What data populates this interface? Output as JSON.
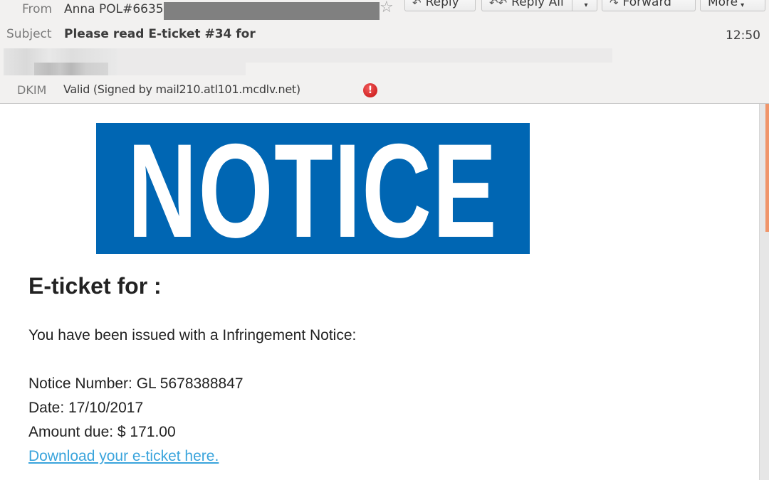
{
  "header": {
    "from_label": "From",
    "from_value": "Anna POL#6635",
    "subject_label": "Subject",
    "subject_value": "Please read E-ticket #34 for",
    "time": "12:50",
    "dkim_label": "DKIM",
    "dkim_value": "Valid (Signed by mail210.atl101.mcdlv.net)",
    "dkim_warning_glyph": "!",
    "star_glyph": "☆"
  },
  "toolbar": {
    "reply_label": "Reply",
    "reply_all_label": "Reply All",
    "forward_label": "Forward",
    "more_label": "More",
    "reply_icon": "↶",
    "reply_all_icon": "↶↶",
    "forward_icon": "↷",
    "dropdown_glyph": "▾"
  },
  "message": {
    "banner_text": "NOTICE",
    "banner_color": "#0066b3",
    "heading": "E-ticket for  :",
    "intro": "You have been issued with a Infringement Notice:",
    "notice_number": "Notice Number: GL 5678388847",
    "date": "Date: 17/10/2017",
    "amount_due": "Amount due: $ 171.00",
    "download_link": "Download your e-ticket here.",
    "link_color": "#3aa4dc"
  }
}
